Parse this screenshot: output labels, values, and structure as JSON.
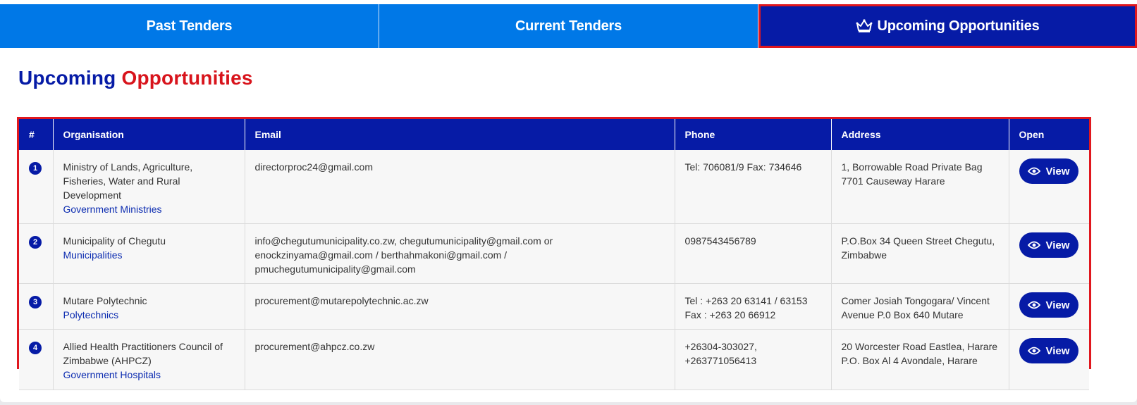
{
  "tabs": [
    {
      "label": "Past Tenders"
    },
    {
      "label": "Current Tenders"
    },
    {
      "label": "Upcoming Opportunities"
    }
  ],
  "heading": {
    "part1": "Upcoming",
    "part2": "Opportunities"
  },
  "table": {
    "headers": [
      "#",
      "Organisation",
      "Email",
      "Phone",
      "Address",
      "Open"
    ],
    "rows": [
      {
        "num": "1",
        "org": "Ministry of Lands, Agriculture, Fisheries, Water and Rural Development",
        "category": "Government Ministries",
        "email": "directorproc24@gmail.com",
        "phone": "Tel: 706081/9 Fax: 734646",
        "address": "1, Borrowable Road Private Bag 7701 Causeway Harare",
        "action": "View"
      },
      {
        "num": "2",
        "org": "Municipality of Chegutu",
        "category": "Municipalities",
        "email": "info@chegutumunicipality.co.zw, chegutumunicipality@gmail.com or enockzinyama@gmail.com / berthahmakoni@gmail.com / pmuchegutumunicipality@gmail.com",
        "phone": "0987543456789",
        "address": "P.O.Box 34 Queen Street Chegutu, Zimbabwe",
        "action": "View"
      },
      {
        "num": "3",
        "org": "Mutare Polytechnic",
        "category": "Polytechnics",
        "email": "procurement@mutarepolytechnic.ac.zw",
        "phone": "Tel : +263 20 63141 / 63153 Fax : +263 20 66912",
        "address": "Comer Josiah Tongogara/ Vincent Avenue P.0 Box 640 Mutare",
        "action": "View"
      },
      {
        "num": "4",
        "org": "Allied Health Practitioners Council of Zimbabwe (AHPCZ)",
        "category": "Government Hospitals",
        "email": "procurement@ahpcz.co.zw",
        "phone": "+26304-303027, +263771056413",
        "address": "20 Worcester Road Eastlea, Harare P.O. Box Al 4 Avondale, Harare",
        "action": "View"
      }
    ]
  },
  "icons": {
    "active_tab": "crown-icon",
    "view": "eye-icon"
  },
  "colors": {
    "primary": "#0078e7",
    "dark": "#061ba6",
    "accent": "#d8141c",
    "highlight": "#e0171e"
  }
}
